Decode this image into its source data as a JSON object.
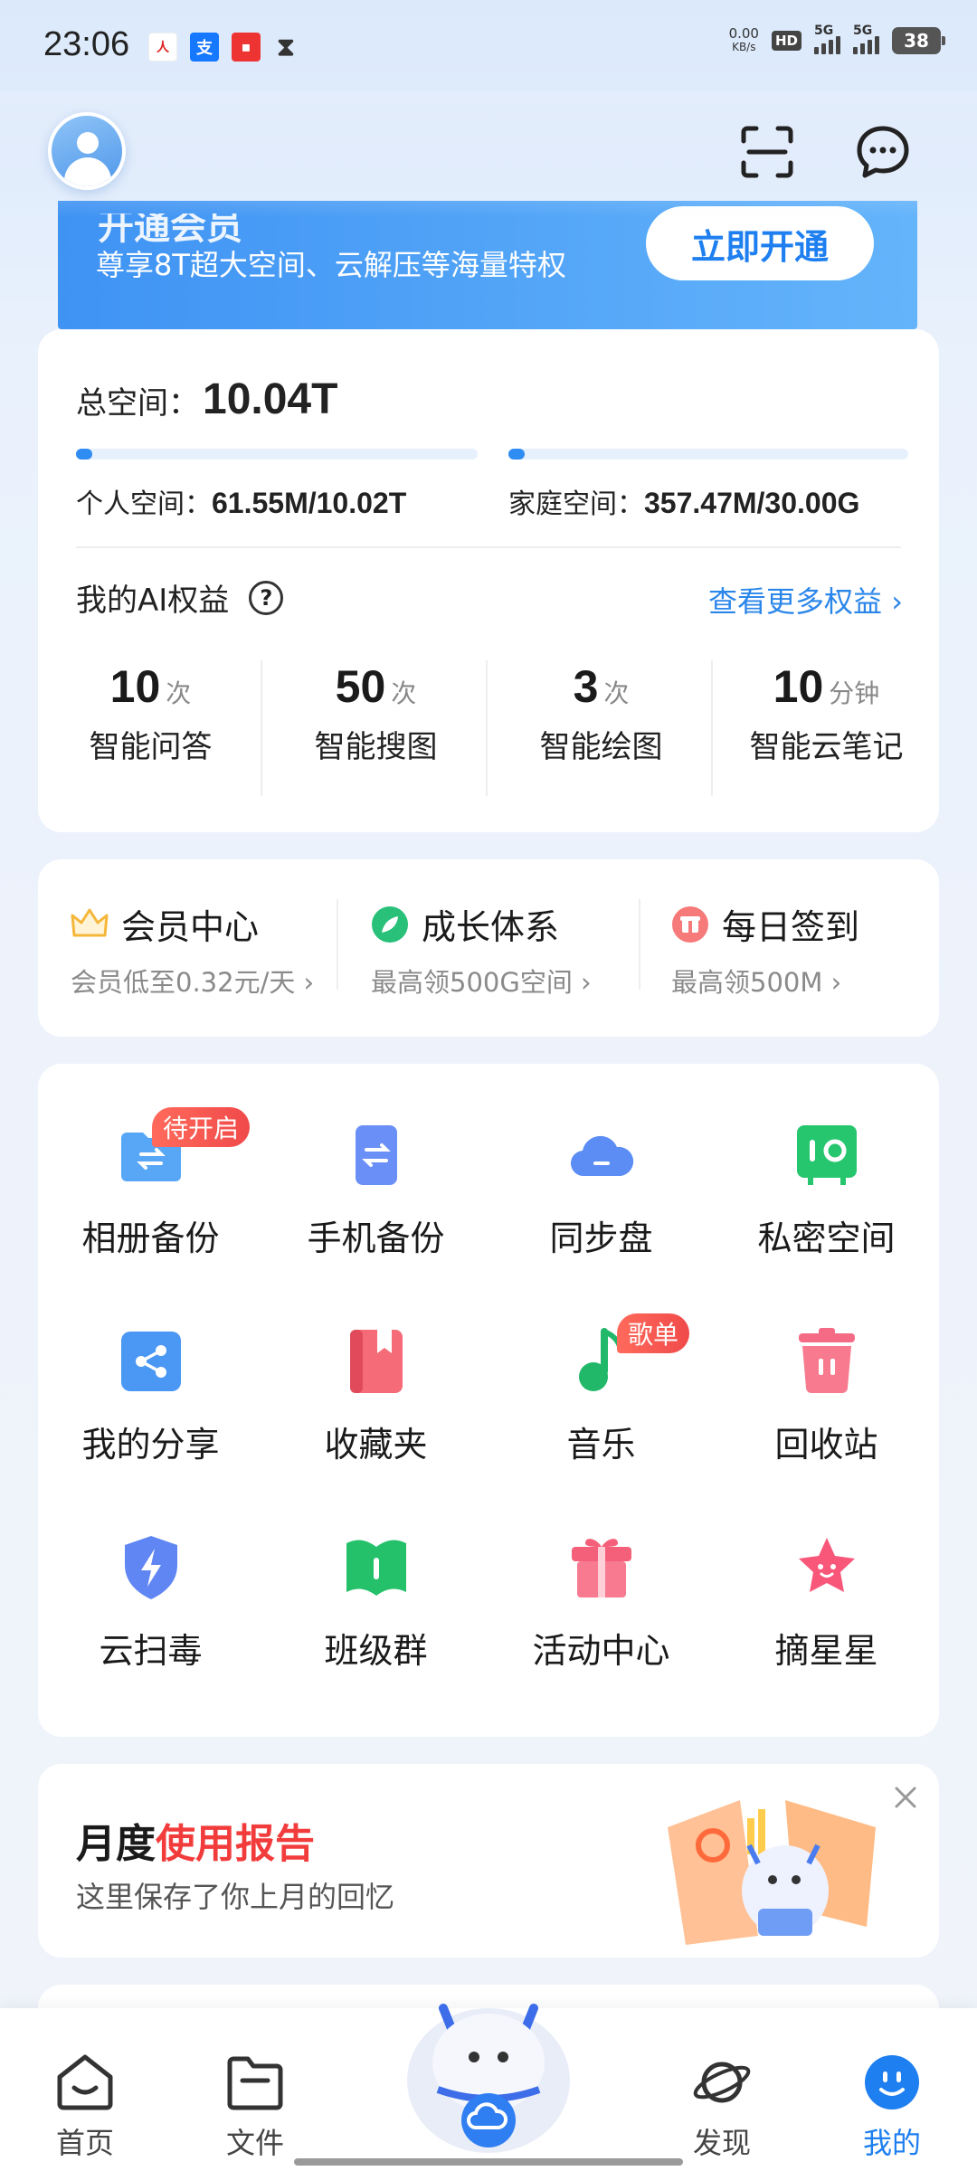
{
  "status_bar": {
    "time": "23:06",
    "net_speed_value": "0.00",
    "net_speed_unit": "KB/s",
    "hd_label": "HD",
    "sim1_label": "5G",
    "sim2_label": "5G",
    "battery": "38",
    "notification_icons": [
      "people-daily-icon",
      "alipay-icon",
      "app-icon",
      "hourglass-icon"
    ]
  },
  "header": {
    "scan_icon": "scan-icon",
    "message_icon": "message-icon"
  },
  "promo": {
    "title_partial": "开通会员",
    "subtitle": "尊享8T超大空间、云解压等海量特权",
    "button": "立即开通"
  },
  "storage": {
    "total_label": "总空间：",
    "total_value": "10.04T",
    "personal_label": "个人空间：",
    "personal_value": "61.55M/10.02T",
    "personal_used_fraction": 0.006,
    "family_label": "家庭空间：",
    "family_value": "357.47M/30.00G",
    "family_used_fraction": 0.012
  },
  "ai_rights": {
    "title": "我的AI权益",
    "more": "查看更多权益",
    "items": [
      {
        "num": "10",
        "unit": "次",
        "label": "智能问答"
      },
      {
        "num": "50",
        "unit": "次",
        "label": "智能搜图"
      },
      {
        "num": "3",
        "unit": "次",
        "label": "智能绘图"
      },
      {
        "num": "10",
        "unit": "分钟",
        "label": "智能云笔记"
      }
    ]
  },
  "membership": [
    {
      "title": "会员中心",
      "sub": "会员低至0.32元/天",
      "color": "#f5b73b"
    },
    {
      "title": "成长体系",
      "sub": "最高领500G空间",
      "color": "#29c07a"
    },
    {
      "title": "每日签到",
      "sub": "最高领500M",
      "color": "#f26b6b"
    }
  ],
  "grid": [
    {
      "label": "相册备份",
      "icon": "album-backup-icon",
      "badge": "待开启"
    },
    {
      "label": "手机备份",
      "icon": "phone-backup-icon",
      "badge": ""
    },
    {
      "label": "同步盘",
      "icon": "sync-cloud-icon",
      "badge": ""
    },
    {
      "label": "私密空间",
      "icon": "safe-icon",
      "badge": ""
    },
    {
      "label": "我的分享",
      "icon": "share-icon",
      "badge": ""
    },
    {
      "label": "收藏夹",
      "icon": "bookmark-icon",
      "badge": ""
    },
    {
      "label": "音乐",
      "icon": "music-note-icon",
      "badge": "歌单"
    },
    {
      "label": "回收站",
      "icon": "trash-icon",
      "badge": ""
    },
    {
      "label": "云扫毒",
      "icon": "shield-icon",
      "badge": ""
    },
    {
      "label": "班级群",
      "icon": "book-icon",
      "badge": ""
    },
    {
      "label": "活动中心",
      "icon": "gift-icon",
      "badge": ""
    },
    {
      "label": "摘星星",
      "icon": "star-icon",
      "badge": ""
    }
  ],
  "report": {
    "title_a": "月度",
    "title_b": "使用报告",
    "sub": "这里保存了你上月的回忆"
  },
  "nav": {
    "items": [
      {
        "label": "首页",
        "icon": "home-icon"
      },
      {
        "label": "文件",
        "icon": "folder-icon"
      },
      {
        "label": "",
        "icon": "mascot-cloud-icon"
      },
      {
        "label": "发现",
        "icon": "planet-icon"
      },
      {
        "label": "我的",
        "icon": "smile-icon"
      }
    ],
    "active": "我的"
  },
  "colors": {
    "accent": "#1e7ff0",
    "red": "#f23c3c"
  }
}
